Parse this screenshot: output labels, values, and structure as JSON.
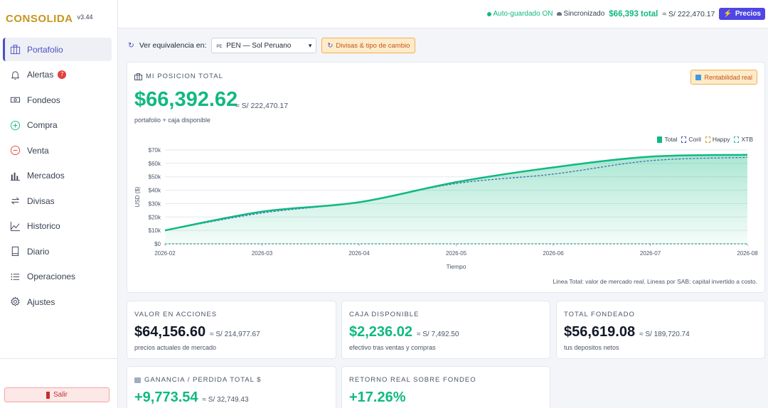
{
  "brand": {
    "name": "CONSOLIDA",
    "version": "v3.44"
  },
  "sidebar": {
    "items": [
      {
        "label": "Portafolio",
        "icon": "portfolio-icon",
        "active": true
      },
      {
        "label": "Alertas",
        "icon": "bell-icon",
        "badge": "7"
      },
      {
        "label": "Fondeos",
        "icon": "cash-icon"
      },
      {
        "label": "Compra",
        "icon": "plus-circle-icon"
      },
      {
        "label": "Venta",
        "icon": "minus-circle-icon"
      },
      {
        "label": "Mercados",
        "icon": "bar-chart-icon"
      },
      {
        "label": "Divisas",
        "icon": "exchange-icon"
      },
      {
        "label": "Historico",
        "icon": "line-chart-icon"
      },
      {
        "label": "Diario",
        "icon": "book-icon"
      },
      {
        "label": "Operaciones",
        "icon": "list-icon"
      },
      {
        "label": "Ajustes",
        "icon": "gear-icon"
      }
    ],
    "logout_label": "Salir"
  },
  "topbar": {
    "autosave": "Auto-guardado ON",
    "sync": "Sincronizado",
    "total_usd": "$66,393 total",
    "total_pen": "≈ S/ 222,470.17",
    "prices_label": "Precios"
  },
  "toolbar": {
    "equivalence_label": "Ver equivalencia en:",
    "currency_flag": "PE",
    "currency_value": "PEN — Sol Peruano",
    "fx_button": "Divisas & tipo de cambio"
  },
  "position": {
    "title": "MI POSICION TOTAL",
    "value": "$66,392.62",
    "value_pen": "≈ S/ 222,470.17",
    "subtitle": "portafolio + caja disponible",
    "rent_button": "Rentabilidad real",
    "note": "Linea Total: valor de mercado real. Lineas por SAB: capital invertido a costo."
  },
  "chart_data": {
    "type": "area",
    "x": [
      "2026-02",
      "2026-03",
      "2026-04",
      "2026-05",
      "2026-06",
      "2026-07",
      "2026-08"
    ],
    "xlabel": "Tiempo",
    "ylabel": "USD ($)",
    "ylim": [
      0,
      70000
    ],
    "yticks": [
      "$0",
      "$10k",
      "$20k",
      "$30k",
      "$40k",
      "$50k",
      "$60k",
      "$70k"
    ],
    "legend_position": "top-right",
    "grid": true,
    "series": [
      {
        "name": "Total",
        "color": "#10b981",
        "values": [
          10000,
          24000,
          31000,
          46000,
          57000,
          65000,
          66393
        ]
      },
      {
        "name": "Coril",
        "color": "#4c51bf",
        "values": [
          10000,
          23000,
          31000,
          45000,
          52000,
          62000,
          64500
        ]
      },
      {
        "name": "Happy",
        "color": "#d69e2e",
        "values": [
          0,
          0,
          0,
          0,
          0,
          0,
          0
        ]
      },
      {
        "name": "XTB",
        "color": "#38b2ac",
        "values": [
          0,
          0,
          0,
          0,
          0,
          0,
          0
        ]
      }
    ]
  },
  "stats": [
    {
      "title": "VALOR EN ACCIONES",
      "value": "$64,156.60",
      "pen": "≈ S/ 214,977.67",
      "sub": "precios actuales de mercado",
      "green": false
    },
    {
      "title": "CAJA DISPONIBLE",
      "value": "$2,236.02",
      "pen": "≈ S/ 7,492.50",
      "sub": "efectivo tras ventas y compras",
      "green": true
    },
    {
      "title": "TOTAL FONDEADO",
      "value": "$56,619.08",
      "pen": "≈ S/ 189,720.74",
      "sub": "tus depositos netos",
      "green": false
    },
    {
      "title": "GANANCIA / PERDIDA TOTAL $",
      "value": "+9,773.54",
      "pen": "≈ S/ 32,749.43",
      "green": true
    },
    {
      "title": "RETORNO REAL SOBRE FONDEO",
      "value": "+17.26%",
      "green": true
    }
  ]
}
